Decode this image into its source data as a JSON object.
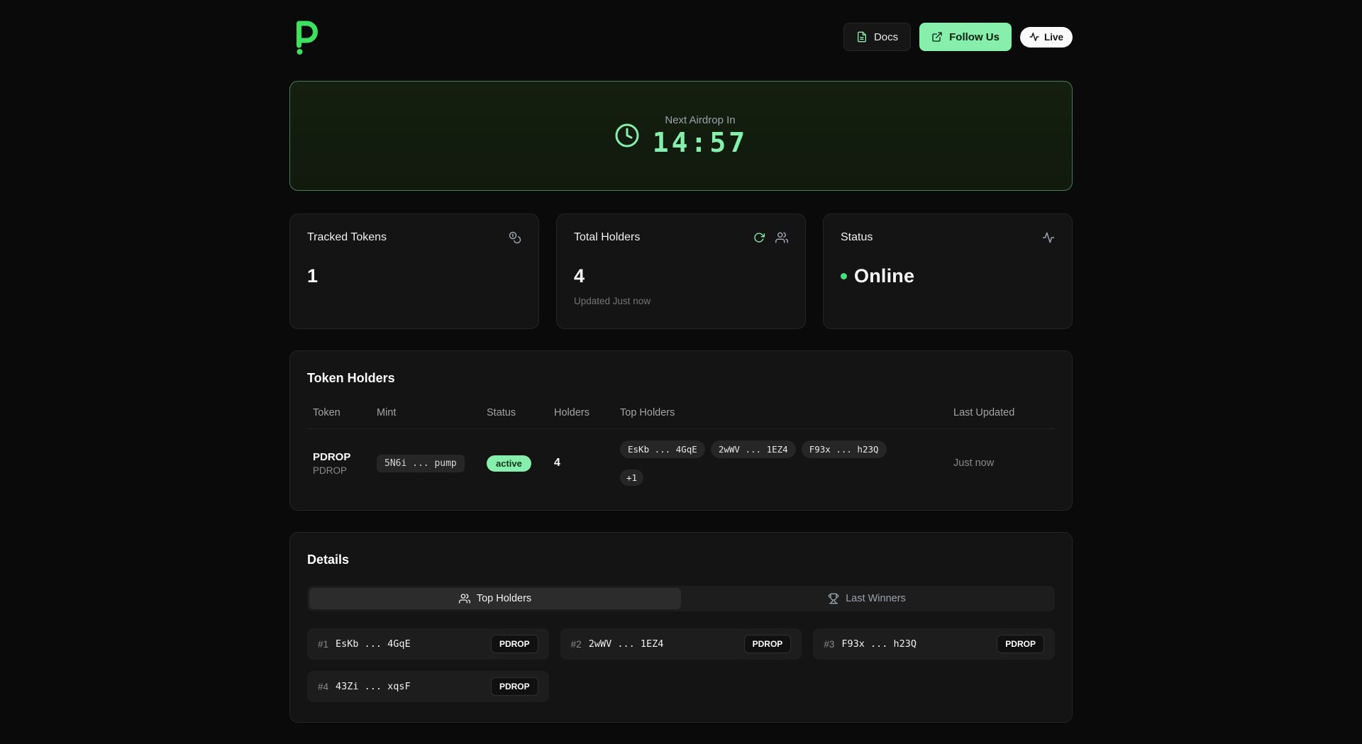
{
  "colors": {
    "accent": "#86efac",
    "logo_green": "#3fdf5f",
    "online": "#4ade80"
  },
  "header": {
    "docs_label": "Docs",
    "follow_us_label": "Follow Us",
    "live_label": "Live"
  },
  "airdrop_banner": {
    "label": "Next Airdrop In",
    "countdown": "14:57"
  },
  "stats": {
    "tracked_tokens": {
      "title": "Tracked Tokens",
      "value": "1"
    },
    "total_holders": {
      "title": "Total Holders",
      "value": "4",
      "updated": "Updated Just now"
    },
    "status": {
      "title": "Status",
      "value": "Online"
    }
  },
  "token_holders": {
    "title": "Token Holders",
    "columns": [
      "Token",
      "Mint",
      "Status",
      "Holders",
      "Top Holders",
      "Last Updated"
    ],
    "row": {
      "token_name": "PDROP",
      "token_symbol": "PDROP",
      "mint": "5N6i ... pump",
      "status": "active",
      "holders": "4",
      "top_holders": [
        "EsKb ... 4GqE",
        "2wWV ... 1EZ4",
        "F93x ... h23Q"
      ],
      "more": "+1",
      "last_updated": "Just now"
    }
  },
  "details": {
    "title": "Details",
    "tabs": {
      "top_holders": "Top Holders",
      "last_winners": "Last Winners"
    },
    "holders": [
      {
        "rank": "#1",
        "address": "EsKb ... 4GqE",
        "token": "PDROP"
      },
      {
        "rank": "#2",
        "address": "2wWV ... 1EZ4",
        "token": "PDROP"
      },
      {
        "rank": "#3",
        "address": "F93x ... h23Q",
        "token": "PDROP"
      },
      {
        "rank": "#4",
        "address": "43Zi ... xqsF",
        "token": "PDROP"
      }
    ]
  }
}
